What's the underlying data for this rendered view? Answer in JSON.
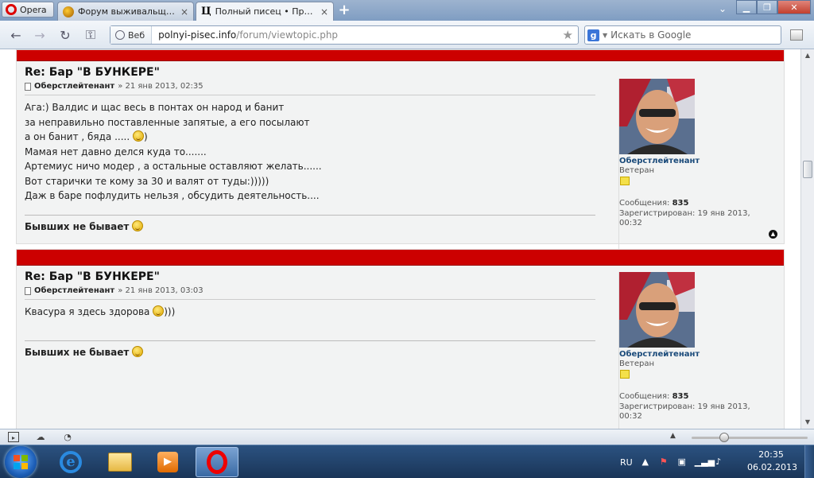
{
  "browser": {
    "menu_label": "Opera",
    "tabs": [
      {
        "label": "Форум выживальщик...",
        "state": "inactive"
      },
      {
        "label": "Полный писец • Прос...",
        "state": "active"
      }
    ],
    "tab_close": "×",
    "new_tab": "+",
    "address": {
      "mode_label": "Веб",
      "host": "polnyi-pisec.info",
      "path": "/forum/viewtopic.php"
    },
    "search_placeholder": "Искать в Google",
    "search_engine_letter": "g"
  },
  "posts": [
    {
      "title": "Re: Бар \"В БУНКЕРЕ\"",
      "author": "Оберстлейтенант",
      "date": "» 21 янв 2013, 02:35",
      "lines": [
        "Ага:) Валдис и щас весь в понтах он народ и банит",
        "за неправильно поставленные запятые, а его посылают",
        "а он банит , бяда .....",
        "Мамая нет давно делся куда то.......",
        "Артемиус ничо модер , а остальные оставляют желать......",
        "Вот старички те кому за 30 и валят от туды:)))))",
        "Даж в баре пофлудить нельзя , обсудить деятельность...."
      ],
      "line3_suffix": ")",
      "signature": "Бывших не бывает",
      "profile": {
        "name": "Оберстлейтенант",
        "rank": "Ветеран",
        "posts_label": "Сообщения:",
        "posts_value": "835",
        "registered_label": "Зарегистрирован:",
        "registered_value": "19 янв 2013, 00:32"
      }
    },
    {
      "title": "Re: Бар \"В БУНКЕРЕ\"",
      "author": "Оберстлейтенант",
      "date": "» 21 янв 2013, 03:03",
      "lines": [
        "Квасура я здесь здорова"
      ],
      "line1_suffix": ")))",
      "signature": "Бывших не бывает",
      "profile": {
        "name": "Оберстлейтенант",
        "rank": "Ветеран",
        "posts_label": "Сообщения:",
        "posts_value": "835",
        "registered_label": "Зарегистрирован:",
        "registered_value": "19 янв 2013, 00:32"
      }
    }
  ],
  "taskbar": {
    "language": "RU",
    "time": "20:35",
    "date": "06.02.2013"
  },
  "colors": {
    "post_header": "#cc0000",
    "username": "#1a4a7a"
  }
}
